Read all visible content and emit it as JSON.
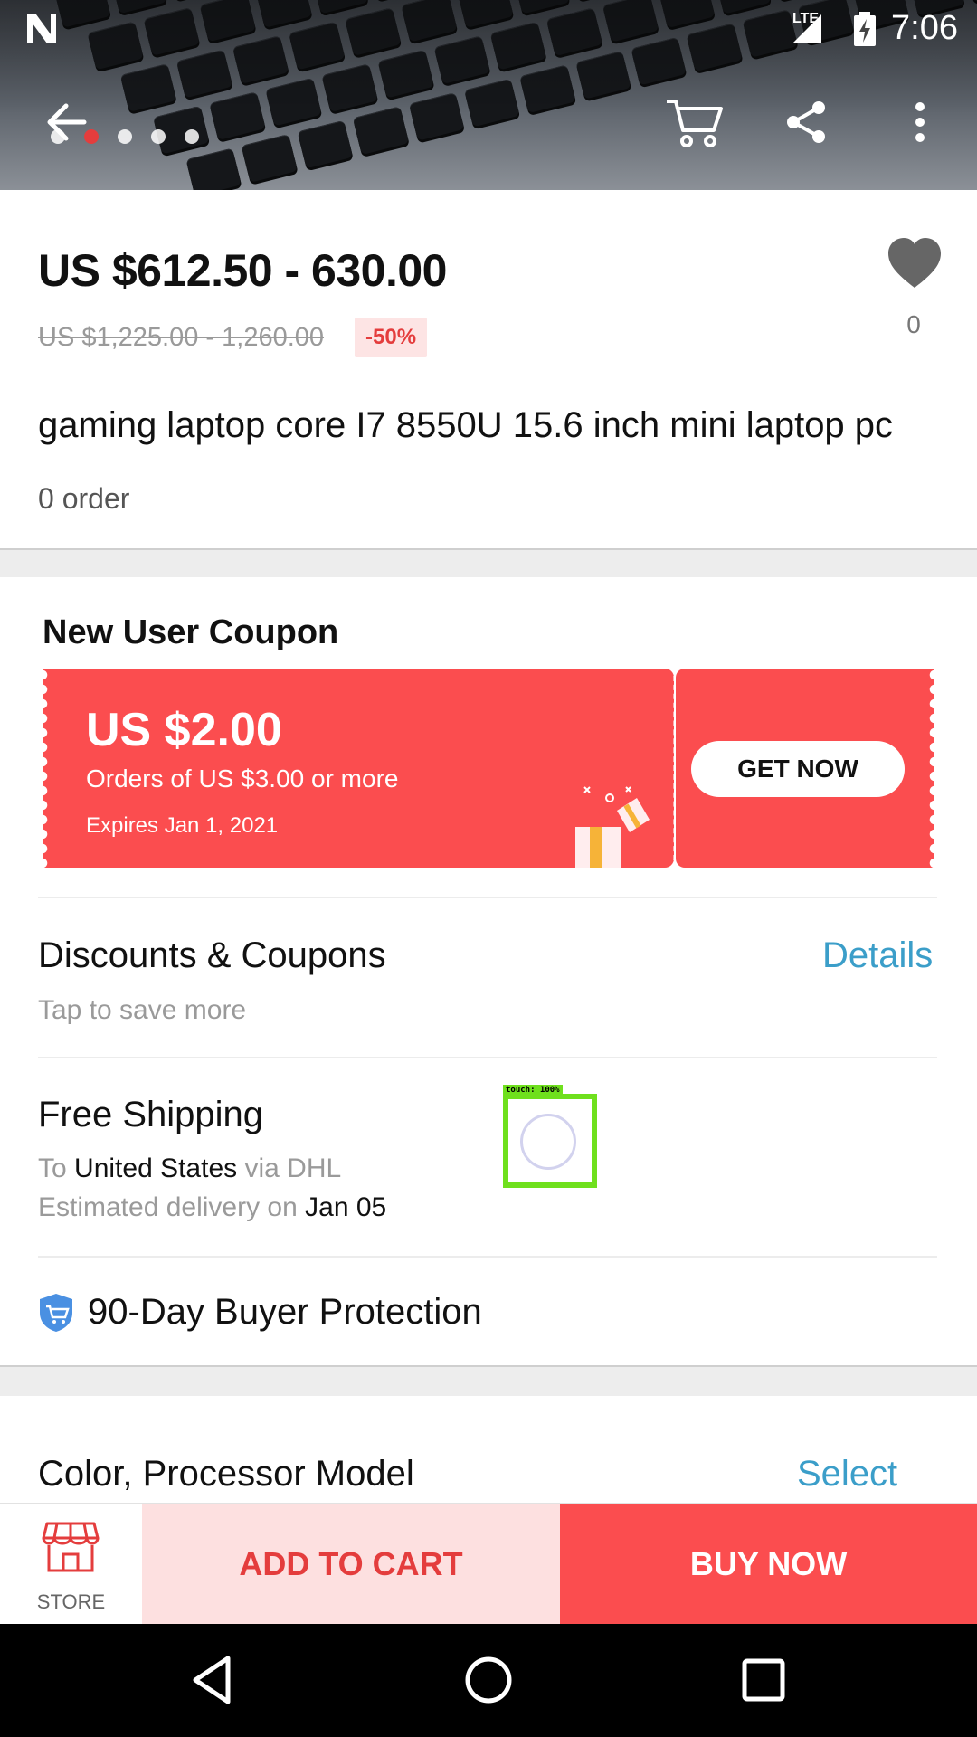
{
  "status_bar": {
    "network": "LTE",
    "time": "7:06"
  },
  "gallery": {
    "dots_total": 6,
    "active_index": 1
  },
  "product": {
    "price_range": "US $612.50 - 630.00",
    "original_price": "US $1,225.00 - 1,260.00",
    "discount": "-50%",
    "wishlist_count": "0",
    "title": "gaming laptop core I7 8550U 15.6 inch mini laptop pc",
    "orders": "0 order"
  },
  "coupon": {
    "heading": "New User Coupon",
    "amount": "US $2.00",
    "condition": "Orders of US $3.00 or more",
    "expires": "Expires Jan 1, 2021",
    "button": "GET NOW"
  },
  "discounts": {
    "title": "Discounts & Coupons",
    "subtitle": "Tap to save more",
    "link": "Details"
  },
  "shipping": {
    "title": "Free Shipping",
    "to_prefix": "To",
    "destination": "United States",
    "via": "via DHL",
    "eta_prefix": "Estimated delivery on",
    "eta_date": "Jan 05"
  },
  "touch_overlay": {
    "label": "touch: 100%"
  },
  "protection": {
    "label": "90-Day Buyer Protection"
  },
  "variant": {
    "title": "Color, Processor Model",
    "link": "Select"
  },
  "actions": {
    "store": "STORE",
    "add_to_cart": "ADD TO CART",
    "buy_now": "BUY NOW"
  },
  "colors": {
    "accent_red": "#fb4d4f",
    "price_red": "#e43d3d",
    "link_blue": "#3b9ec9"
  }
}
